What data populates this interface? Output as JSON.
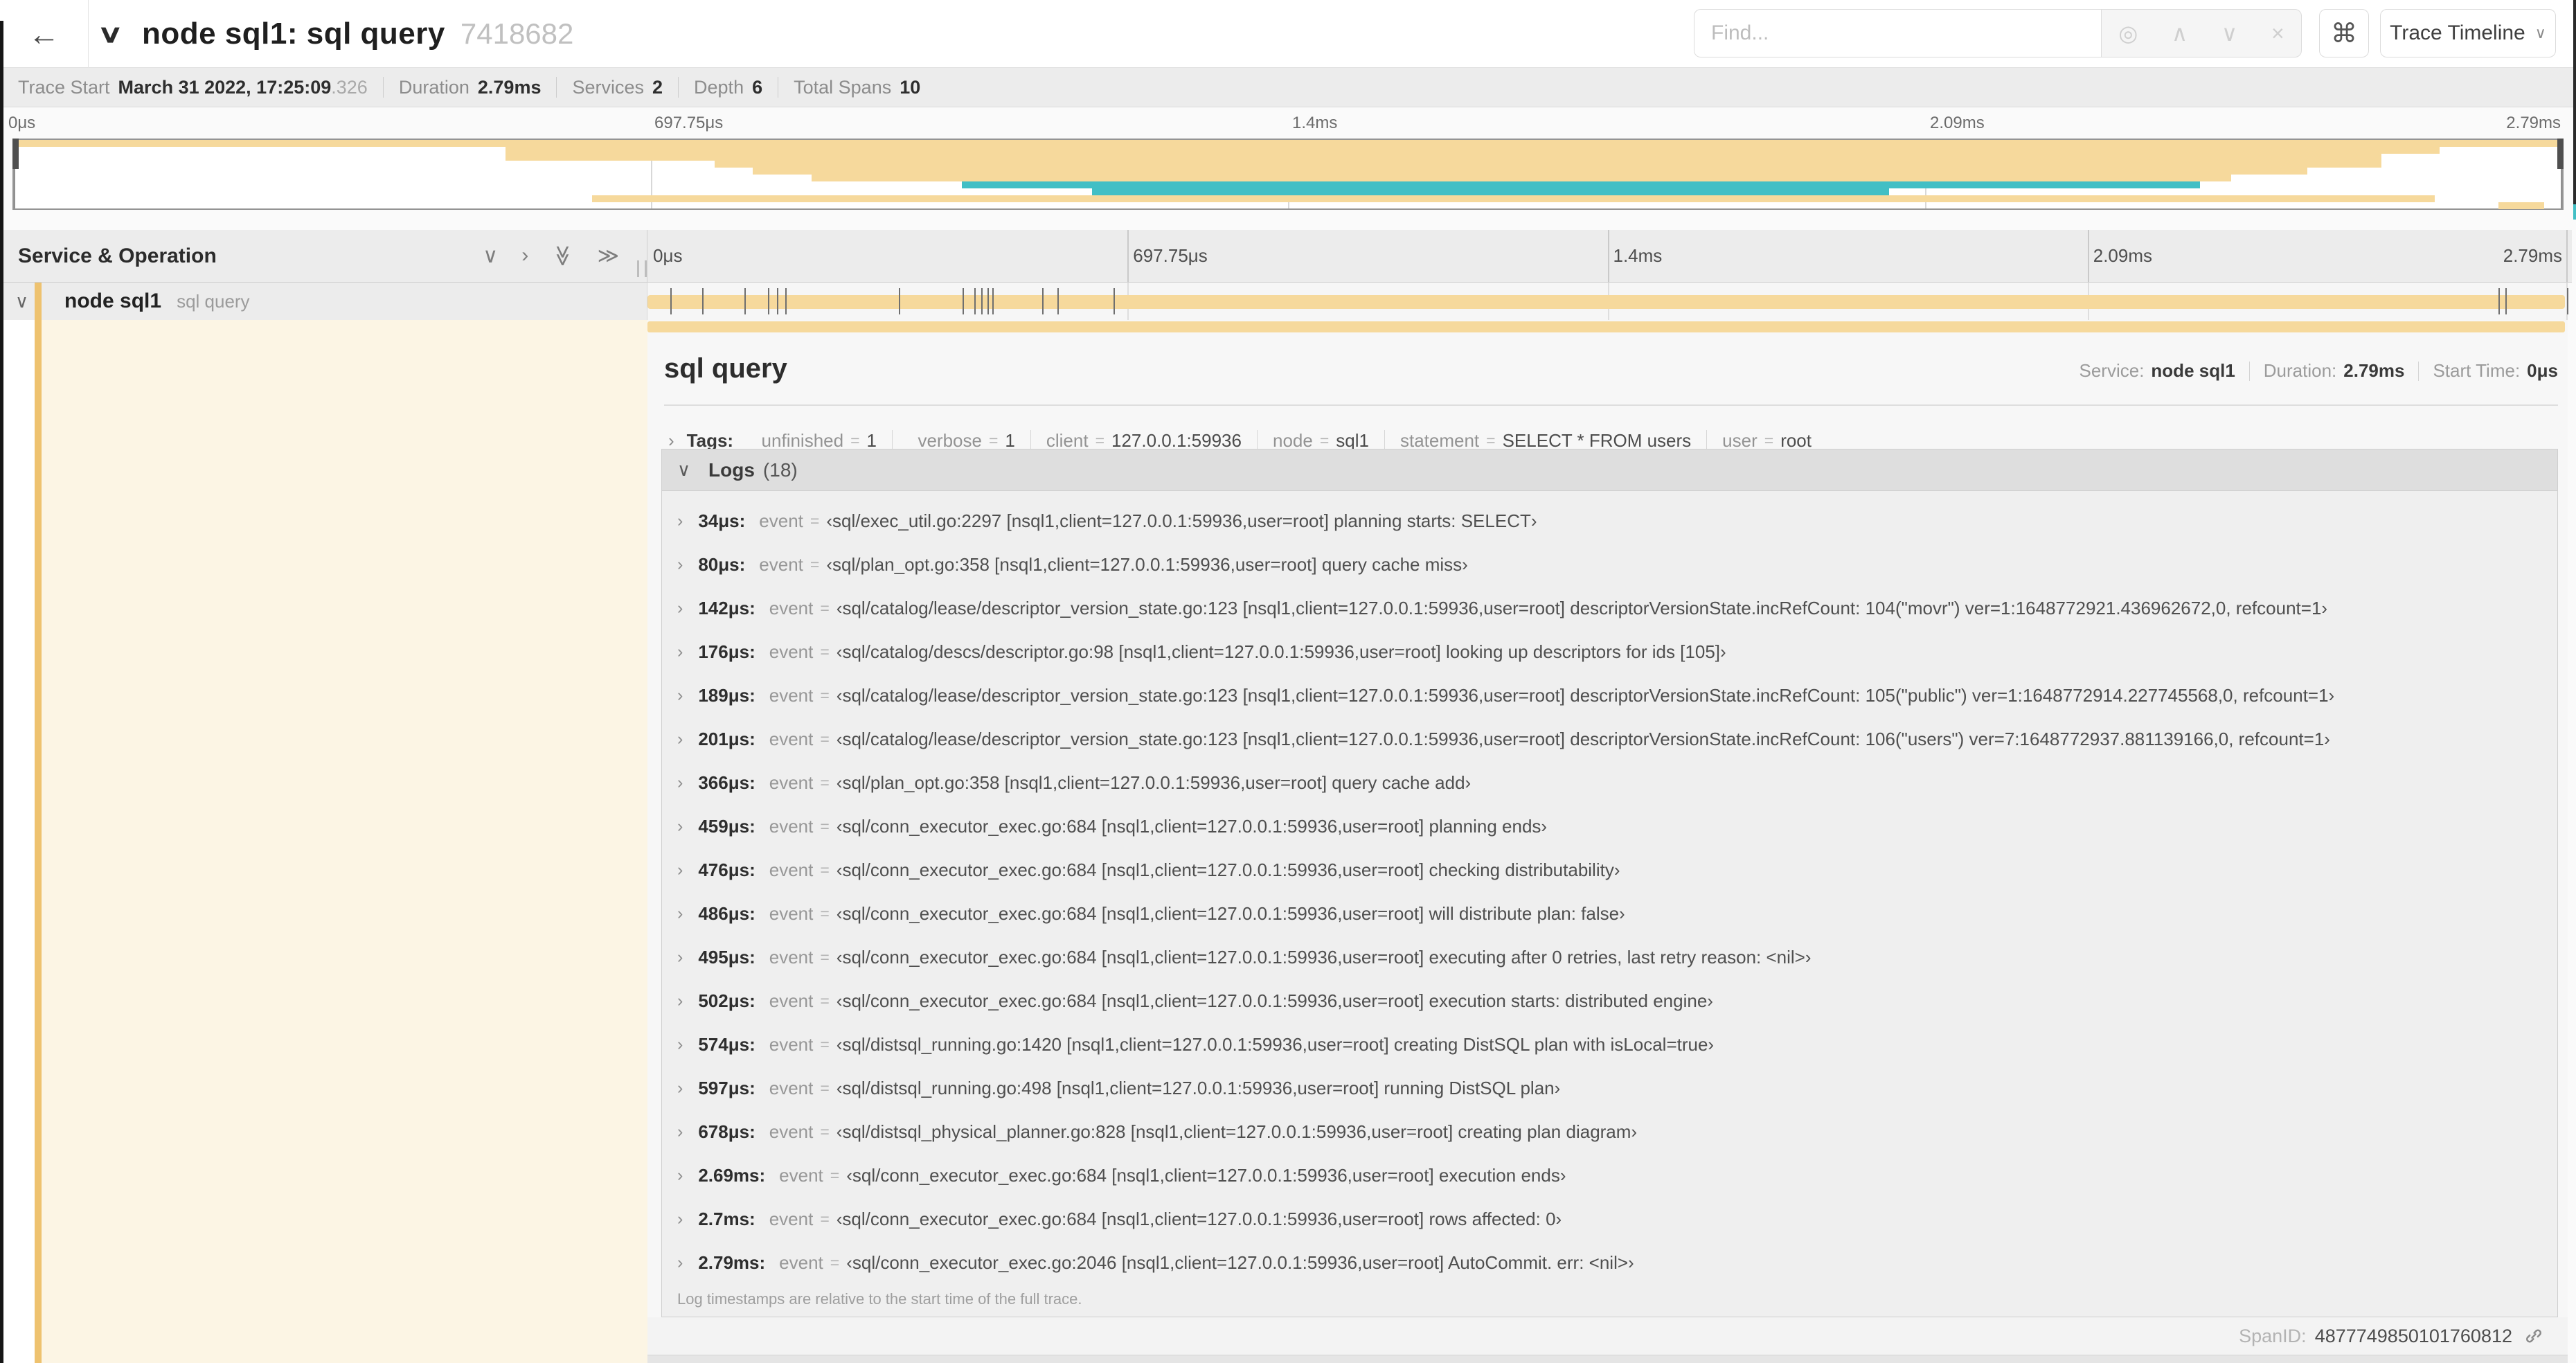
{
  "colors": {
    "tan": "#f6d99c",
    "amber": "#eec26f",
    "teal": "#42bfc5",
    "cream": "#fcf5e4"
  },
  "header": {
    "back_icon": "←",
    "collapse_icon": "∨",
    "title": "node sql1: sql query",
    "trace_id_short": "7418682",
    "find_placeholder": "Find...",
    "locate_icon": "◎",
    "prev_icon": "∧",
    "next_icon": "∨",
    "clear_icon": "×",
    "shortcut_icon": "⌘",
    "view_button_label": "Trace Timeline",
    "view_button_carat": "∨"
  },
  "trace_info": [
    {
      "label": "Trace Start",
      "value": "March 31 2022, 17:25:09",
      "suffix": ".326"
    },
    {
      "label": "Duration",
      "value": "2.79ms"
    },
    {
      "label": "Services",
      "value": "2"
    },
    {
      "label": "Depth",
      "value": "6"
    },
    {
      "label": "Total Spans",
      "value": "10"
    }
  ],
  "chart_data": {
    "type": "bar",
    "title": "trace minimap span bars",
    "x_axis_ticks_percent": [
      0,
      25,
      50,
      75,
      100
    ],
    "axis_labels": [
      "0μs",
      "697.75μs",
      "1.4ms",
      "2.09ms",
      "2.79ms"
    ],
    "trace_duration_us": 2790,
    "spans": [
      {
        "left": 0,
        "width": 100,
        "color": "tan"
      },
      {
        "left": 19.3,
        "width": 75.9,
        "color": "tan"
      },
      {
        "left": 19.3,
        "width": 73.6,
        "color": "tan"
      },
      {
        "left": 27.5,
        "width": 65.4,
        "color": "tan"
      },
      {
        "left": 29.0,
        "width": 61.0,
        "color": "tan"
      },
      {
        "left": 31.3,
        "width": 55.7,
        "color": "tan"
      },
      {
        "left": 37.2,
        "width": 48.6,
        "color": "teal"
      },
      {
        "left": 42.3,
        "width": 31.3,
        "color": "teal"
      },
      {
        "left": 22.7,
        "width": 72.3,
        "color": "tan"
      },
      {
        "left": 97.5,
        "width": 1.8,
        "color": "tan"
      }
    ]
  },
  "timeline": {
    "column_title": "Service & Operation",
    "collapse_one_icon": "∨",
    "expand_one_icon": "›",
    "collapse_all_icon": "≫",
    "expand_all_icon": "≫",
    "tick_labels": [
      "0μs",
      "697.75μs",
      "1.4ms",
      "2.09ms",
      "2.79ms"
    ],
    "tick_positions_percent": [
      0,
      25,
      50,
      75,
      100
    ]
  },
  "span_row": {
    "chevron": "∨",
    "service": "node sql1",
    "operation": "sql query",
    "bar_start_percent": 0,
    "bar_width_percent": 100
  },
  "detail": {
    "title": "sql query",
    "meta": [
      {
        "label": "Service:",
        "value": "node sql1"
      },
      {
        "label": "Duration:",
        "value": "2.79ms"
      },
      {
        "label": "Start Time:",
        "value": "0μs"
      }
    ],
    "tags_chevron": "›",
    "tags_label": "Tags:",
    "tags": [
      {
        "key": "_unfinished",
        "value": "1"
      },
      {
        "key": "_verbose",
        "value": "1"
      },
      {
        "key": "client",
        "value": "127.0.0.1:59936"
      },
      {
        "key": "node",
        "value": "sql1"
      },
      {
        "key": "statement",
        "value": "SELECT * FROM users"
      },
      {
        "key": "user",
        "value": "root"
      }
    ],
    "logs_chevron": "∨",
    "logs_label": "Logs",
    "logs_count": "(18)",
    "log_row_chevron": "›",
    "log_key_label": "event",
    "log_eq": "=",
    "bracket_open": "‹",
    "bracket_close": "›",
    "logs": [
      {
        "t_label": "34μs:",
        "t_us": 34,
        "text": "sql/exec_util.go:2297 [nsql1,client=127.0.0.1:59936,user=root] planning starts: SELECT"
      },
      {
        "t_label": "80μs:",
        "t_us": 80,
        "text": "sql/plan_opt.go:358 [nsql1,client=127.0.0.1:59936,user=root] query cache miss"
      },
      {
        "t_label": "142μs:",
        "t_us": 142,
        "text": "sql/catalog/lease/descriptor_version_state.go:123 [nsql1,client=127.0.0.1:59936,user=root] descriptorVersionState.incRefCount: 104(\"movr\") ver=1:1648772921.436962672,0, refcount=1"
      },
      {
        "t_label": "176μs:",
        "t_us": 176,
        "text": "sql/catalog/descs/descriptor.go:98 [nsql1,client=127.0.0.1:59936,user=root] looking up descriptors for ids [105]"
      },
      {
        "t_label": "189μs:",
        "t_us": 189,
        "text": "sql/catalog/lease/descriptor_version_state.go:123 [nsql1,client=127.0.0.1:59936,user=root] descriptorVersionState.incRefCount: 105(\"public\") ver=1:1648772914.227745568,0, refcount=1"
      },
      {
        "t_label": "201μs:",
        "t_us": 201,
        "text": "sql/catalog/lease/descriptor_version_state.go:123 [nsql1,client=127.0.0.1:59936,user=root] descriptorVersionState.incRefCount: 106(\"users\") ver=7:1648772937.881139166,0, refcount=1"
      },
      {
        "t_label": "366μs:",
        "t_us": 366,
        "text": "sql/plan_opt.go:358 [nsql1,client=127.0.0.1:59936,user=root] query cache add"
      },
      {
        "t_label": "459μs:",
        "t_us": 459,
        "text": "sql/conn_executor_exec.go:684 [nsql1,client=127.0.0.1:59936,user=root] planning ends"
      },
      {
        "t_label": "476μs:",
        "t_us": 476,
        "text": "sql/conn_executor_exec.go:684 [nsql1,client=127.0.0.1:59936,user=root] checking distributability"
      },
      {
        "t_label": "486μs:",
        "t_us": 486,
        "text": "sql/conn_executor_exec.go:684 [nsql1,client=127.0.0.1:59936,user=root] will distribute plan: false"
      },
      {
        "t_label": "495μs:",
        "t_us": 495,
        "text": "sql/conn_executor_exec.go:684 [nsql1,client=127.0.0.1:59936,user=root] executing after 0 retries, last retry reason: <nil>"
      },
      {
        "t_label": "502μs:",
        "t_us": 502,
        "text": "sql/conn_executor_exec.go:684 [nsql1,client=127.0.0.1:59936,user=root] execution starts: distributed engine"
      },
      {
        "t_label": "574μs:",
        "t_us": 574,
        "text": "sql/distsql_running.go:1420 [nsql1,client=127.0.0.1:59936,user=root] creating DistSQL plan with isLocal=true"
      },
      {
        "t_label": "597μs:",
        "t_us": 597,
        "text": "sql/distsql_running.go:498 [nsql1,client=127.0.0.1:59936,user=root] running DistSQL plan"
      },
      {
        "t_label": "678μs:",
        "t_us": 678,
        "text": "sql/distsql_physical_planner.go:828 [nsql1,client=127.0.0.1:59936,user=root] creating plan diagram"
      },
      {
        "t_label": "2.69ms:",
        "t_us": 2690,
        "text": "sql/conn_executor_exec.go:684 [nsql1,client=127.0.0.1:59936,user=root] execution ends"
      },
      {
        "t_label": "2.7ms:",
        "t_us": 2700,
        "text": "sql/conn_executor_exec.go:684 [nsql1,client=127.0.0.1:59936,user=root] rows affected: 0"
      },
      {
        "t_label": "2.79ms:",
        "t_us": 2790,
        "text": "sql/conn_executor_exec.go:2046 [nsql1,client=127.0.0.1:59936,user=root] AutoCommit. err: <nil>"
      }
    ],
    "logs_footer": "Log timestamps are relative to the start time of the full trace.",
    "span_id_label": "SpanID:",
    "span_id": "4877749850101760812"
  }
}
